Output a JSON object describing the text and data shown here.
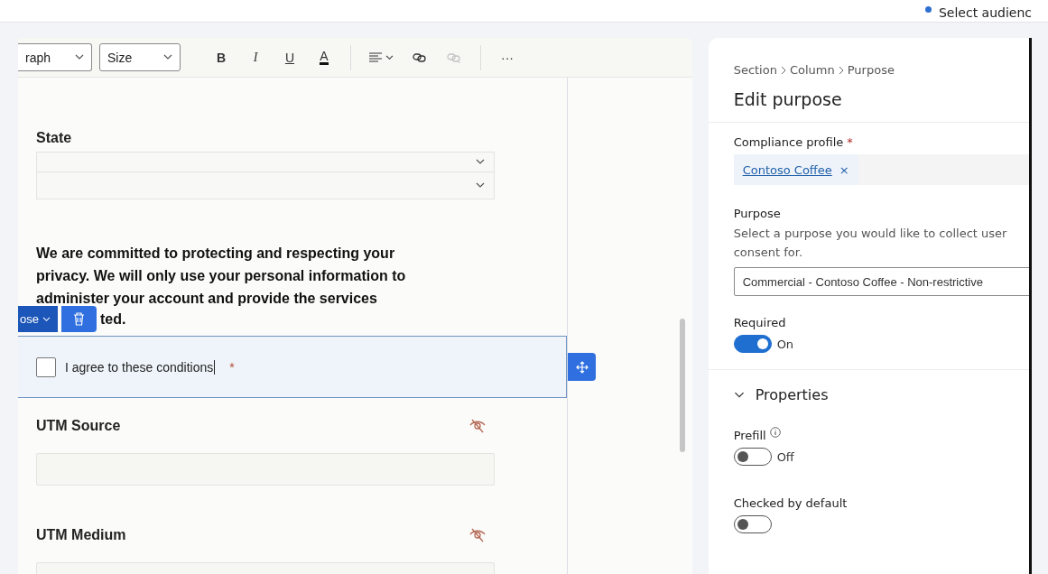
{
  "top_bar": {
    "audience_button": "Select audienc"
  },
  "toolbar": {
    "paragraph_select": "raph",
    "size_select": "Size",
    "buttons": [
      {
        "kind": "bold",
        "label": "B",
        "disabled": false
      },
      {
        "kind": "italic",
        "label": "I",
        "disabled": false
      },
      {
        "kind": "underline",
        "label": "U",
        "disabled": false
      },
      {
        "kind": "font_color",
        "label": "A",
        "disabled": false
      },
      {
        "kind": "separator"
      },
      {
        "kind": "align",
        "disabled": false
      },
      {
        "kind": "link",
        "disabled": false
      },
      {
        "kind": "unlink",
        "disabled": true
      },
      {
        "kind": "separator"
      },
      {
        "kind": "more",
        "label": "···",
        "disabled": false
      }
    ]
  },
  "form": {
    "state_label": "State",
    "consent_text": "We are committed to protecting and respecting your privacy. We will only use your personal information to administer your account and provide the services",
    "element_menu": "ose",
    "consent_tail": "ted.",
    "checkbox": {
      "label": "I agree to these conditions",
      "checked": false,
      "required_mark": "*",
      "selected": true
    },
    "hidden_fields": [
      {
        "label": "UTM Source",
        "hidden": true
      },
      {
        "label": "UTM Medium",
        "hidden": true
      }
    ]
  },
  "panel": {
    "breadcrumb": [
      "Section",
      "Column",
      "Purpose"
    ],
    "title": "Edit purpose",
    "compliance": {
      "label": "Compliance profile",
      "required_mark": "*",
      "tag": "Contoso Coffee",
      "tag_remove": "×"
    },
    "purpose": {
      "label": "Purpose",
      "help": "Select a purpose you would like to collect user consent for.",
      "value": "Commercial - Contoso Coffee - Non-restrictive"
    },
    "required_toggle": {
      "label": "Required",
      "on": true,
      "state_text": "On"
    },
    "properties": {
      "title": "Properties",
      "expanded": true,
      "toggles": [
        {
          "label": "Prefill",
          "info": true,
          "on": false,
          "state_text": "Off"
        },
        {
          "label": "Checked by default",
          "info": false,
          "on": false
        }
      ]
    }
  }
}
